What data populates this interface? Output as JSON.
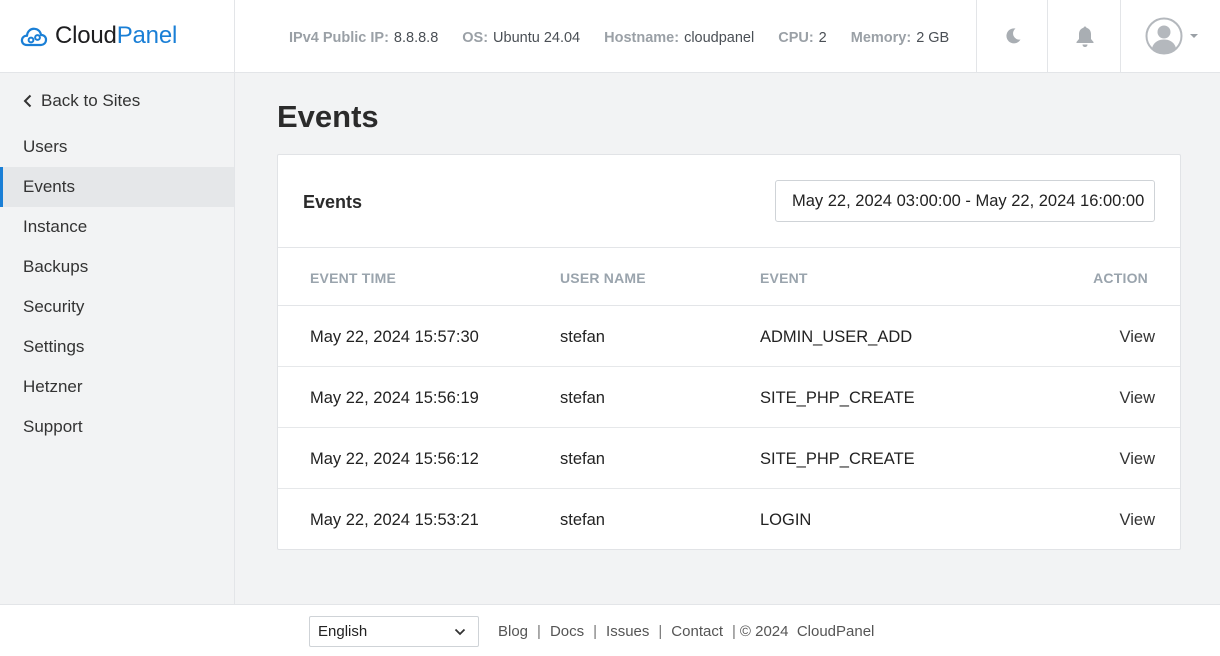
{
  "brand": {
    "part1": "Cloud",
    "part2": "Panel",
    "color": "#1a7fd6"
  },
  "sysinfo": [
    {
      "key": "IPv4 Public IP:",
      "value": "8.8.8.8"
    },
    {
      "key": "OS:",
      "value": "Ubuntu 24.04"
    },
    {
      "key": "Hostname:",
      "value": "cloudpanel"
    },
    {
      "key": "CPU:",
      "value": "2"
    },
    {
      "key": "Memory:",
      "value": "2 GB"
    }
  ],
  "header_icons": [
    "moon-icon",
    "bell-icon",
    "user-avatar-icon",
    "caret-down-icon"
  ],
  "sidebar": {
    "back_label": "Back to Sites",
    "items": [
      {
        "label": "Users",
        "active": false
      },
      {
        "label": "Events",
        "active": true
      },
      {
        "label": "Instance",
        "active": false
      },
      {
        "label": "Backups",
        "active": false
      },
      {
        "label": "Security",
        "active": false
      },
      {
        "label": "Settings",
        "active": false
      },
      {
        "label": "Hetzner",
        "active": false
      },
      {
        "label": "Support",
        "active": false
      }
    ]
  },
  "page": {
    "title": "Events"
  },
  "card": {
    "title": "Events",
    "date_range": "May 22, 2024 03:00:00 - May 22, 2024 16:00:00"
  },
  "table": {
    "columns": [
      "EVENT TIME",
      "USER NAME",
      "EVENT",
      "ACTION"
    ],
    "rows": [
      {
        "time": "May 22, 2024 15:57:30",
        "user": "stefan",
        "event": "ADMIN_USER_ADD",
        "action": "View"
      },
      {
        "time": "May 22, 2024 15:56:19",
        "user": "stefan",
        "event": "SITE_PHP_CREATE",
        "action": "View"
      },
      {
        "time": "May 22, 2024 15:56:12",
        "user": "stefan",
        "event": "SITE_PHP_CREATE",
        "action": "View"
      },
      {
        "time": "May 22, 2024 15:53:21",
        "user": "stefan",
        "event": "LOGIN",
        "action": "View"
      }
    ]
  },
  "footer": {
    "language": "English",
    "links": [
      "Blog",
      "Docs",
      "Issues",
      "Contact"
    ],
    "copyright": "© 2024  CloudPanel"
  }
}
